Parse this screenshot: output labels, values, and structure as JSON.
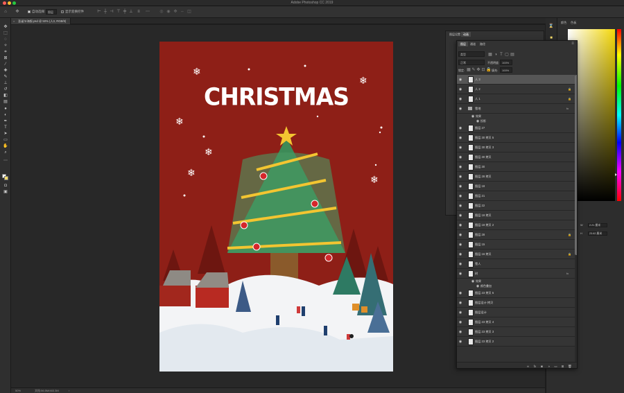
{
  "window": {
    "app_title": "Adobe Photoshop CC 2019"
  },
  "options_bar": {
    "auto_select_label": "自动选择:",
    "auto_select_target": "图层",
    "show_transform_label": "显示变换控件"
  },
  "document": {
    "tab_label": "圣诞节海报.psd @ 50% (人3, RGB/8)",
    "zoom": "50%",
    "doc_info": "文档:56.5M/463.3M",
    "artwork_title": "CHRISTMAS"
  },
  "right_dock": {
    "tab_color": "颜色",
    "tab_swatches": "色板"
  },
  "floating_panel": {
    "tabs": [
      "图层设置",
      "动画"
    ]
  },
  "layers_panel": {
    "tabs": [
      "图层",
      "通道",
      "路径"
    ],
    "filter_kind": "类型",
    "blend_mode": "正常",
    "opacity_label": "不透明度:",
    "opacity_value": "100%",
    "lock_label": "锁定:",
    "fill_label": "填充:",
    "fill_value": "100%",
    "layers": [
      {
        "name": "人 3",
        "type": "layer",
        "selected": true,
        "lock": false
      },
      {
        "name": "人 2",
        "type": "layer",
        "selected": false,
        "lock": true
      },
      {
        "name": "人 1",
        "type": "layer",
        "selected": false,
        "lock": true
      },
      {
        "name": "雪地",
        "type": "group",
        "selected": false,
        "lock": false,
        "fx": true
      },
      {
        "name": "效果",
        "type": "effect"
      },
      {
        "name": "投影",
        "type": "effect-item"
      },
      {
        "name": "图层 27",
        "type": "layer",
        "selected": false,
        "lock": false
      },
      {
        "name": "图层 30 拷贝 5",
        "type": "layer",
        "selected": false,
        "lock": false
      },
      {
        "name": "图层 30 拷贝 3",
        "type": "layer",
        "selected": false,
        "lock": false
      },
      {
        "name": "图层 30 拷贝",
        "type": "layer",
        "selected": false,
        "lock": false
      },
      {
        "name": "图层 30",
        "type": "layer",
        "selected": false,
        "lock": false
      },
      {
        "name": "图层 28 拷贝",
        "type": "layer",
        "selected": false,
        "lock": false
      },
      {
        "name": "图层 18",
        "type": "layer",
        "selected": false,
        "lock": false
      },
      {
        "name": "图层 21",
        "type": "layer",
        "selected": false,
        "lock": false
      },
      {
        "name": "图层 22",
        "type": "layer",
        "selected": false,
        "lock": false
      },
      {
        "name": "图层 18 拷贝",
        "type": "layer",
        "selected": false,
        "lock": false
      },
      {
        "name": "图层 18 拷贝 2",
        "type": "layer",
        "selected": false,
        "lock": false
      },
      {
        "name": "图层 28",
        "type": "layer",
        "selected": false,
        "lock": true
      },
      {
        "name": "图层 15",
        "type": "layer",
        "selected": false,
        "lock": false
      },
      {
        "name": "图层 16 拷贝",
        "type": "layer",
        "selected": false,
        "lock": true
      },
      {
        "name": "雪人",
        "type": "layer",
        "selected": false,
        "lock": false
      },
      {
        "name": "树",
        "type": "layer",
        "selected": false,
        "lock": false,
        "fx": true
      },
      {
        "name": "效果",
        "type": "effect"
      },
      {
        "name": "颜色叠加",
        "type": "effect-item"
      },
      {
        "name": "图层 23 拷贝 5",
        "type": "layer",
        "selected": false,
        "lock": false
      },
      {
        "name": "图层设计 拷贝",
        "type": "layer",
        "selected": false,
        "lock": false
      },
      {
        "name": "图层设计",
        "type": "layer",
        "selected": false,
        "lock": false
      },
      {
        "name": "图层 23 拷贝 4",
        "type": "layer",
        "selected": false,
        "lock": false
      },
      {
        "name": "图层 23 拷贝 3",
        "type": "layer",
        "selected": false,
        "lock": false
      },
      {
        "name": "图层 23 拷贝 2",
        "type": "layer",
        "selected": false,
        "lock": false
      }
    ]
  },
  "properties": {
    "w_value": "2.21 厘米",
    "h_value": "23.62 厘米"
  },
  "colors": {
    "poster_red": "#8e1f17",
    "tree_green": "#3d8a57",
    "snow": "#ffffff",
    "star": "#f3c531",
    "ui_bg": "#282828"
  }
}
